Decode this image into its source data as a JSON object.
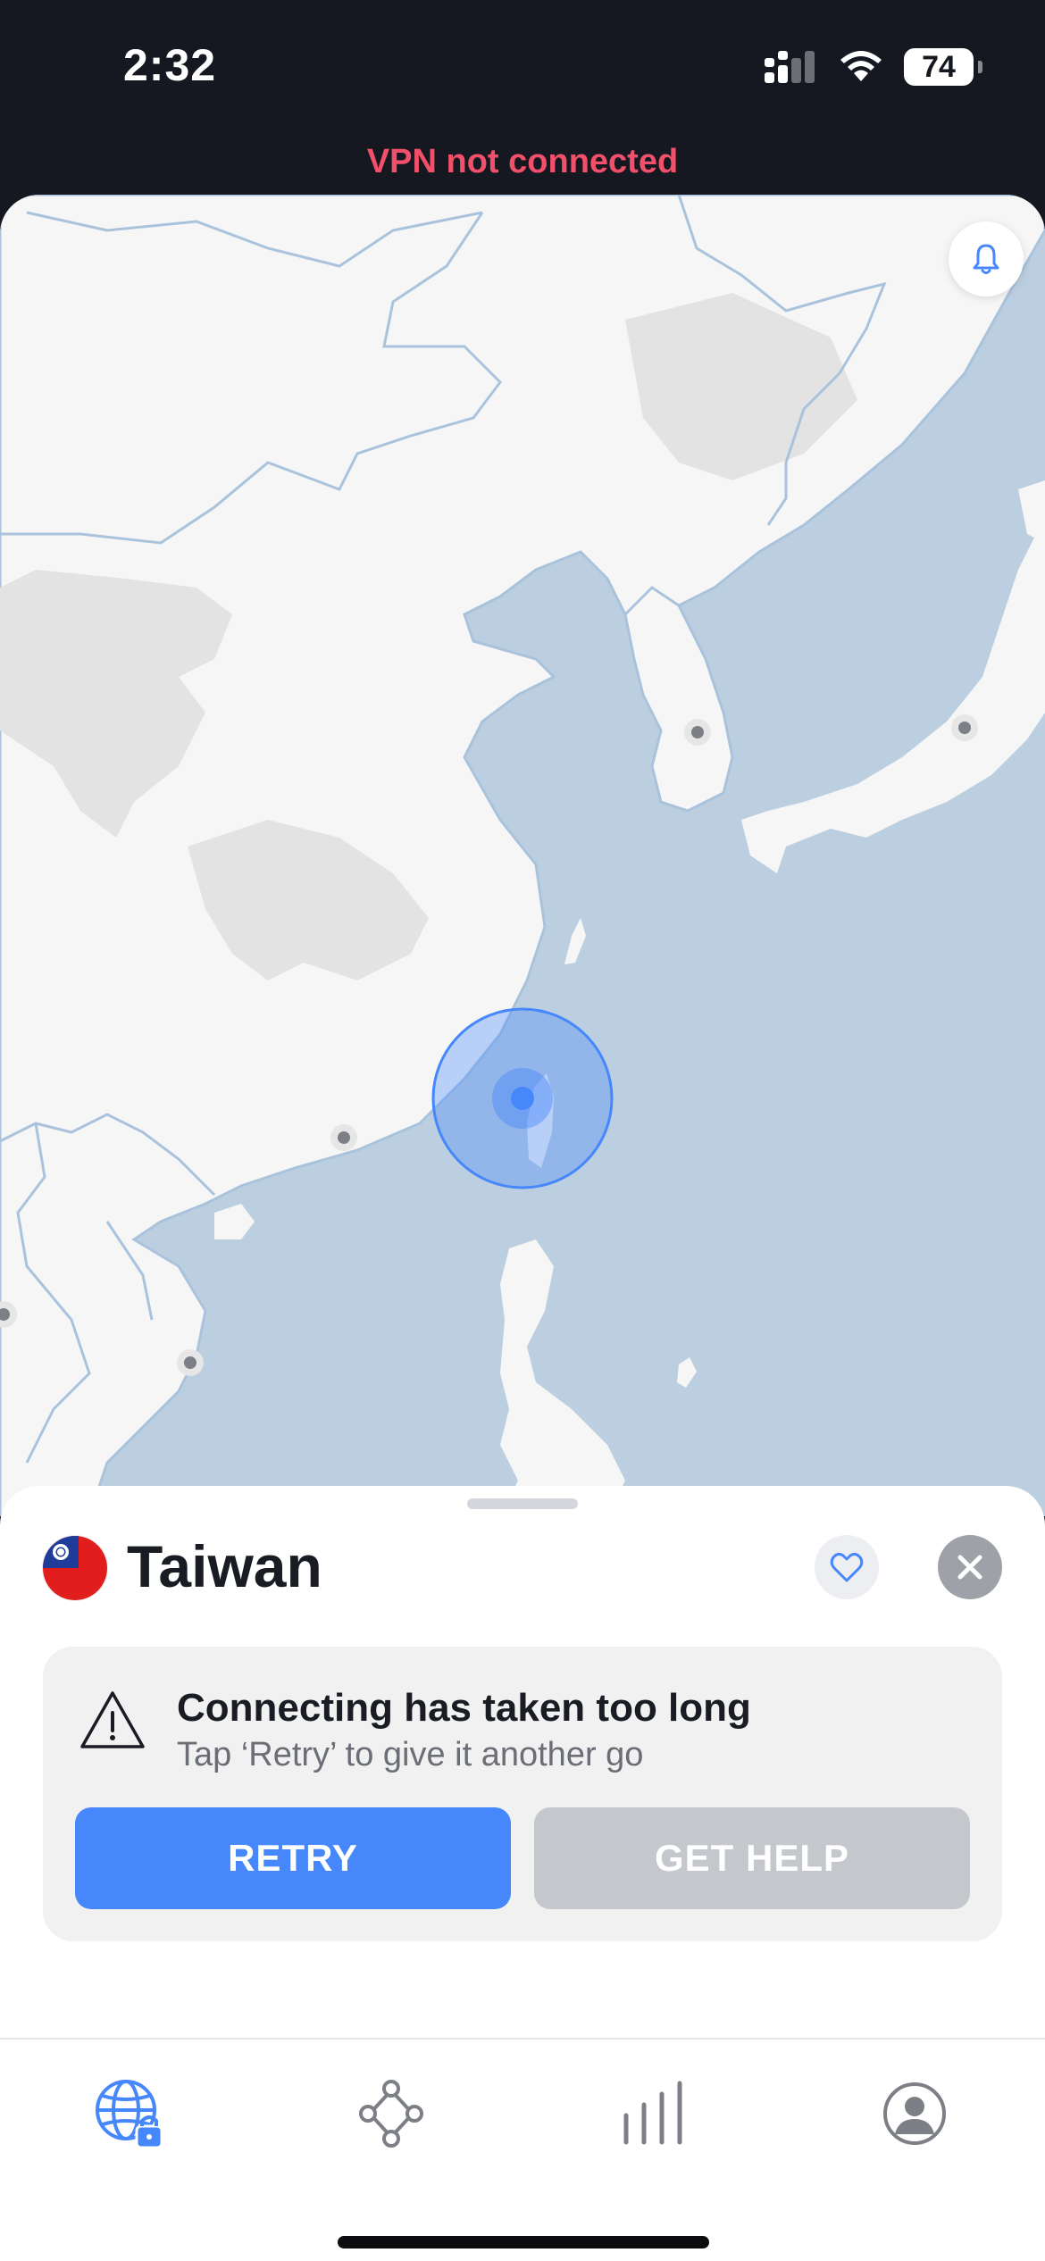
{
  "status_bar": {
    "time": "2:32",
    "battery": "74",
    "icons": [
      "cellular-signal-icon",
      "wifi-icon",
      "battery-icon"
    ]
  },
  "vpn_status": "VPN not connected",
  "map": {
    "icons": [
      "bell-icon",
      "server-pin-icon",
      "selected-location-pin-icon"
    ],
    "colors": {
      "water": "#bccfe0",
      "land": "#f6f6f6",
      "highland": "#e3e3e3",
      "border": "#a9c3dd",
      "accent": "#4687fb"
    }
  },
  "sheet": {
    "country": "Taiwan",
    "flag_icon": "taiwan-flag-icon",
    "alert": {
      "title": "Connecting has taken too long",
      "subtitle": "Tap ‘Retry’ to give it another go",
      "icon": "warning-icon"
    },
    "buttons": {
      "retry": "RETRY",
      "help": "GET HELP"
    },
    "actions": [
      "heart-icon",
      "close-icon"
    ]
  },
  "tabs": [
    {
      "name": "tab-map",
      "icon": "globe-lock-icon",
      "active": true
    },
    {
      "name": "tab-meshnet",
      "icon": "meshnet-icon",
      "active": false
    },
    {
      "name": "tab-stats",
      "icon": "bars-icon",
      "active": false
    },
    {
      "name": "tab-profile",
      "icon": "profile-icon",
      "active": false
    }
  ],
  "colors": {
    "accent": "#4687fb",
    "danger": "#f2506a",
    "topbar": "#161821"
  }
}
